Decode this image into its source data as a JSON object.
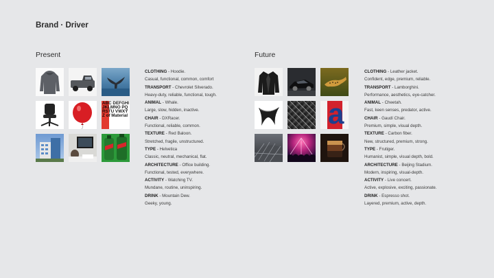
{
  "title": "Brand · Driver",
  "present": {
    "heading": "Present",
    "images": [
      "hoodie-image",
      "pickup-truck-image",
      "whale-tail-image",
      "office-chair-image",
      "red-balloon-image",
      "helvetica-type-image",
      "office-building-image",
      "watching-tv-image",
      "mountain-dew-image"
    ],
    "type_sample_text": "ABC DEFGHI JKLMNO PQRSTU VWXYZ of Material",
    "items": [
      {
        "category": "CLOTHING",
        "value": "Hoodie.",
        "desc": "Casual, functional, common, comfort"
      },
      {
        "category": "TRANSPORT",
        "value": "Chevrolet Silverado.",
        "desc": "Heavy-duty, reliable, functional, tough."
      },
      {
        "category": "ANIMAL",
        "value": "Whale.",
        "desc": "Large, slow, hidden, inactive."
      },
      {
        "category": "CHAIR",
        "value": "DXRacer.",
        "desc": "Functional, reliable, common."
      },
      {
        "category": "TEXTURE",
        "value": "Red Baloon.",
        "desc": "Stretched, fragile, unstructured."
      },
      {
        "category": "TYPE",
        "value": "Helvetica",
        "desc": "Classic, neutral, mechanical, flat."
      },
      {
        "category": "ARCHITECTURE",
        "value": "Office building.",
        "desc": "Functional, tested, everywhere."
      },
      {
        "category": "ACTIVITY",
        "value": "Watching TV.",
        "desc": "Mundane, routine, uninspiring."
      },
      {
        "category": "DRINK",
        "value": "Mountain Dew.",
        "desc": "Geeky, young."
      }
    ]
  },
  "future": {
    "heading": "Future",
    "images": [
      "leather-jacket-image",
      "lamborghini-image",
      "cheetah-image",
      "gaudi-chair-image",
      "carbon-fiber-image",
      "frutiger-type-image",
      "beijing-stadium-image",
      "live-concert-image",
      "espresso-shot-image"
    ],
    "type_sample_text": "a",
    "items": [
      {
        "category": "CLOTHING",
        "value": "Leather jacket.",
        "desc": "Confident, edge, premium, reliable."
      },
      {
        "category": "TRANSPORT",
        "value": "Lamborghini.",
        "desc": "Performance, aesthetics, eye-catcher."
      },
      {
        "category": "ANIMAL",
        "value": "Cheetah.",
        "desc": "Fast, keen senses, predator, active."
      },
      {
        "category": "CHAIR",
        "value": "Gaudí Chair.",
        "desc": "Premium, simple, visual depth."
      },
      {
        "category": "TEXTURE",
        "value": "Carbon fiber.",
        "desc": "New, structured, premium, strong."
      },
      {
        "category": "TYPE",
        "value": "Frutiger.",
        "desc": "Humanist, simple, visual depth, bold."
      },
      {
        "category": "ARCHITECTURE",
        "value": "Beijing Stadium.",
        "desc": "Modern, inspiring, visual-depth."
      },
      {
        "category": "ACTIVITY",
        "value": "Live concert.",
        "desc": "Active, explosive, exciting, passionate."
      },
      {
        "category": "DRINK",
        "value": "Espresso shot.",
        "desc": "Layered, premium, active, depth."
      }
    ]
  },
  "colors": {
    "background": "#e6e7e9",
    "balloon": "#d81e24",
    "frutiger_red": "#d2222d",
    "frutiger_blue": "#1d3f8f",
    "dew_green": "#2c9a3a"
  }
}
